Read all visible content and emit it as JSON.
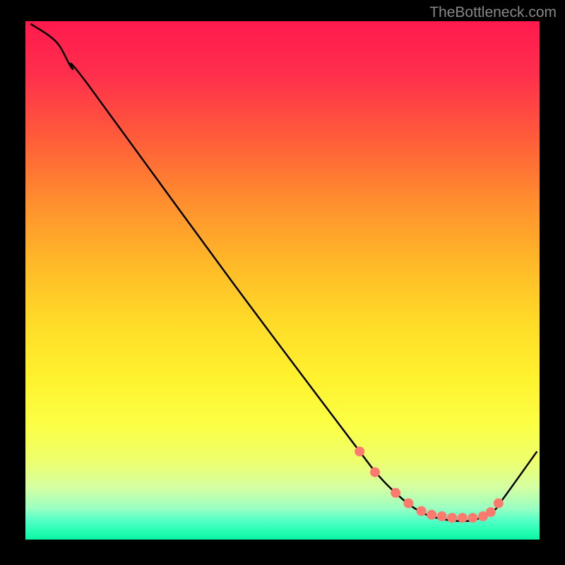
{
  "watermark": "TheBottleneck.com",
  "chart_data": {
    "type": "line",
    "title": "",
    "xlabel": "",
    "ylabel": "",
    "xlim": [
      0,
      100
    ],
    "ylim": [
      0,
      100
    ],
    "series": [
      {
        "name": "curve",
        "x": [
          1,
          6,
          9,
          12,
          40,
          65,
          69,
          72,
          75,
          78,
          80,
          82,
          84,
          86,
          88,
          91,
          93,
          99.5
        ],
        "y": [
          99.5,
          96,
          91,
          88,
          50,
          17,
          12,
          9,
          6.5,
          4.8,
          4.2,
          3.8,
          3.6,
          3.6,
          4,
          5.5,
          8,
          17
        ]
      }
    ],
    "markers": {
      "name": "dots",
      "x": [
        65,
        68,
        72,
        74.5,
        77,
        79,
        81,
        83,
        85,
        87,
        89,
        90.5,
        92
      ],
      "y": [
        17,
        13,
        9,
        7,
        5.5,
        4.8,
        4.5,
        4.2,
        4.2,
        4.2,
        4.5,
        5.3,
        7
      ]
    },
    "gradient": {
      "top_color": "#ff1a4d",
      "mid_color": "#fff22e",
      "bottom_color": "#0af5a3"
    }
  }
}
